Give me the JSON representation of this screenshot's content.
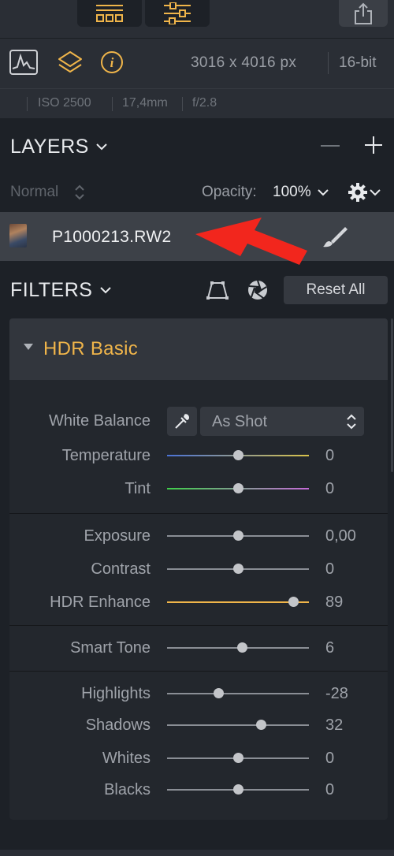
{
  "toolbar": {
    "layout_icon": "grid-layout-icon",
    "adjust_icon": "sliders-icon",
    "share_icon": "share-icon"
  },
  "info": {
    "icons": [
      "histogram-icon",
      "layers-icon",
      "info-icon"
    ],
    "dimensions": "3016 x 4016 px",
    "bit_depth": "16-bit",
    "iso": "ISO 2500",
    "focal_length": "17,4mm",
    "aperture": "f/2.8"
  },
  "layers": {
    "title": "LAYERS",
    "blend_mode": "Normal",
    "opacity_label": "Opacity:",
    "opacity_value": "100%",
    "layer_name": "P1000213.RW2"
  },
  "filters": {
    "title": "FILTERS",
    "reset_label": "Reset All",
    "filter_name": "HDR Basic",
    "white_balance": {
      "label": "White Balance",
      "value": "As Shot"
    },
    "sliders": [
      {
        "label": "Temperature",
        "value": "0",
        "level": 0.5
      },
      {
        "label": "Tint",
        "value": "0",
        "level": 0.5
      },
      {
        "label": "Exposure",
        "value": "0,00",
        "level": 0.5
      },
      {
        "label": "Contrast",
        "value": "0",
        "level": 0.5
      },
      {
        "label": "HDR Enhance",
        "value": "89",
        "level": 0.89
      },
      {
        "label": "Smart Tone",
        "value": "6",
        "level": 0.53
      },
      {
        "label": "Highlights",
        "value": "-28",
        "level": 0.36
      },
      {
        "label": "Shadows",
        "value": "32",
        "level": 0.66
      },
      {
        "label": "Whites",
        "value": "0",
        "level": 0.5
      },
      {
        "label": "Blacks",
        "value": "0",
        "level": 0.5
      }
    ]
  },
  "colors": {
    "accent": "#f0b54a",
    "temperature_start": "#4a72d6",
    "temperature_end": "#d9c34a",
    "tint_start": "#3fcf4a",
    "tint_end": "#c56ad8",
    "hdr_enhance_track": "#f0b54a",
    "annotation_arrow": "#f2261d"
  }
}
